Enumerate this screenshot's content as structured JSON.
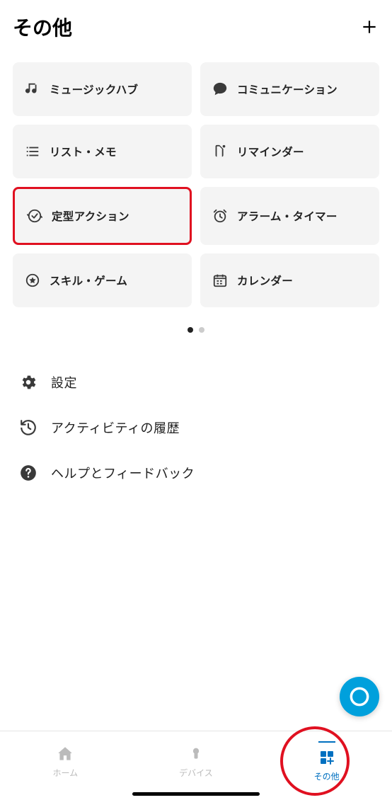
{
  "header": {
    "title": "その他"
  },
  "tiles": [
    {
      "label": "ミュージックハブ",
      "icon": "music-icon"
    },
    {
      "label": "コミュニケーション",
      "icon": "speech-icon"
    },
    {
      "label": "リスト・メモ",
      "icon": "list-icon"
    },
    {
      "label": "リマインダー",
      "icon": "reminder-icon"
    },
    {
      "label": "定型アクション",
      "icon": "routine-icon"
    },
    {
      "label": "アラーム・タイマー",
      "icon": "alarm-icon"
    },
    {
      "label": "スキル・ゲーム",
      "icon": "skill-icon"
    },
    {
      "label": "カレンダー",
      "icon": "calendar-icon"
    }
  ],
  "pagination": {
    "active": 0,
    "count": 2
  },
  "listItems": [
    {
      "label": "設定",
      "icon": "gear-icon"
    },
    {
      "label": "アクティビティの履歴",
      "icon": "history-icon"
    },
    {
      "label": "ヘルプとフィードバック",
      "icon": "help-icon"
    }
  ],
  "bottomNav": [
    {
      "label": "ホーム",
      "icon": "home-icon",
      "active": false
    },
    {
      "label": "デバイス",
      "icon": "device-icon",
      "active": false
    },
    {
      "label": "その他",
      "icon": "more-icon",
      "active": true
    }
  ],
  "highlightedTileIndex": 4,
  "highlightedNavIndex": 2
}
